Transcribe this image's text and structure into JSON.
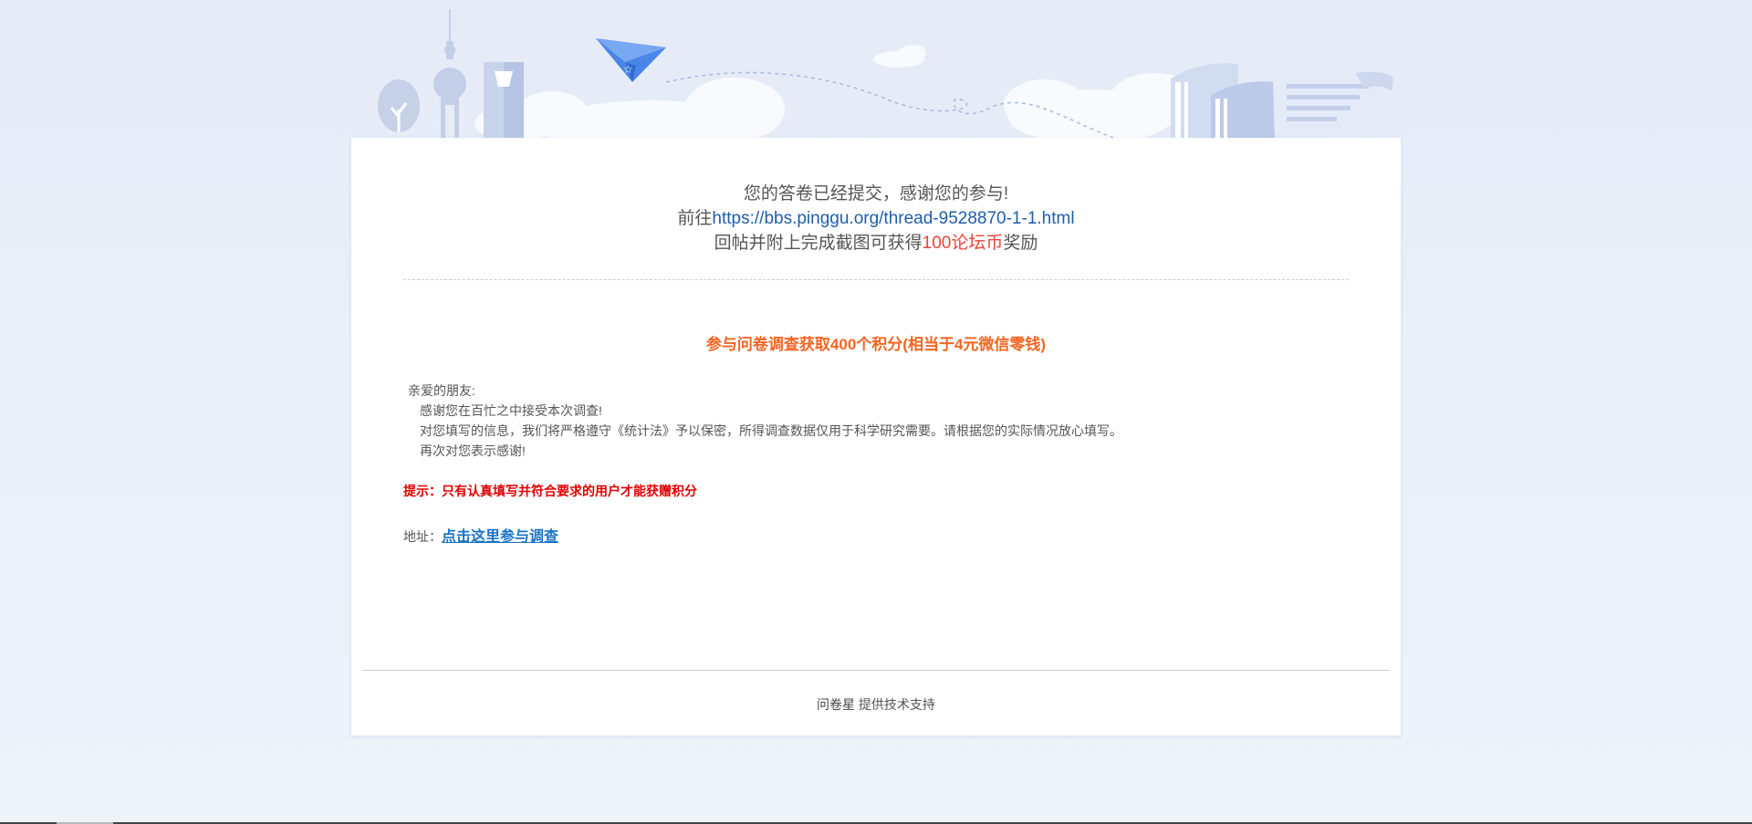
{
  "submission": {
    "line1": "您的答卷已经提交，感谢您的参与!",
    "line2_prefix": "前往",
    "link": "https://bbs.pinggu.org/thread-9528870-1-1.html",
    "line3_prefix": "回帖并附上完成截图可获得",
    "reward": "100论坛币",
    "line3_suffix": "奖励"
  },
  "survey": {
    "title": "参与问卷调查获取400个积分(相当于4元微信零钱)",
    "greeting": "亲爱的朋友:",
    "body": [
      "感谢您在百忙之中接受本次调查!",
      "对您填写的信息，我们将严格遵守《统计法》予以保密，所得调查数据仅用于科学研究需要。请根据您的实际情况放心填写。",
      "再次对您表示感谢!"
    ],
    "tip": "提示：只有认真填写并符合要求的用户才能获赠积分",
    "address_label": "地址：",
    "address_link": "点击这里参与调查"
  },
  "footer": {
    "brand": "问卷星",
    "text": " 提供技术支持"
  },
  "colors": {
    "link": "#1f5ea8",
    "reward": "#e8433a",
    "title": "#f26522",
    "tip": "#e00000",
    "cta": "#1a73c8"
  },
  "icons": {
    "header": "city-skyline-paper-plane-books-illustration"
  }
}
